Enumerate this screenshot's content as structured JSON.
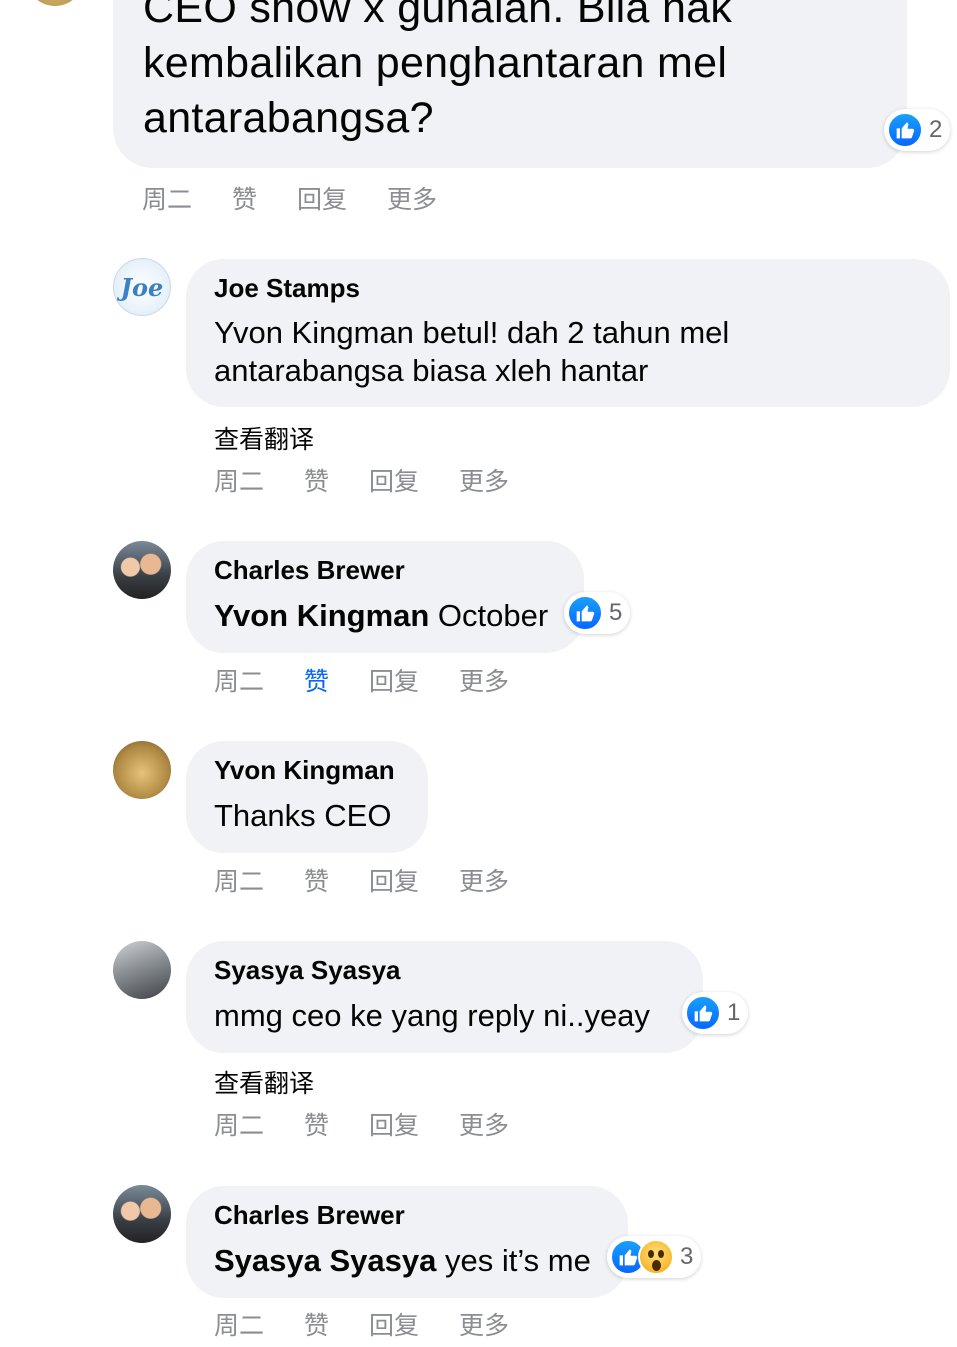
{
  "top_comment": {
    "text": "CEO show x gunalah. Bila nak kembalikan penghantaran mel antarabangsa?",
    "reactions": {
      "icons": [
        "like-icon"
      ],
      "count": "2"
    },
    "actions": {
      "time": "周二",
      "like": "赞",
      "reply": "回复",
      "more": "更多"
    }
  },
  "comments": [
    {
      "author": "Joe Stamps",
      "avatar_text": "Joe",
      "text": "Yvon Kingman betul! dah 2 tahun mel antarabangsa biasa xleh hantar",
      "translate": "查看翻译",
      "actions": {
        "time": "周二",
        "like": "赞",
        "reply": "回复",
        "more": "更多"
      }
    },
    {
      "author": "Charles Brewer",
      "mention": "Yvon Kingman",
      "text": " October",
      "reactions": {
        "icons": [
          "like-icon"
        ],
        "count": "5"
      },
      "actions": {
        "time": "周二",
        "like": "赞",
        "reply": "回复",
        "more": "更多",
        "liked": true
      }
    },
    {
      "author": "Yvon Kingman",
      "text": "Thanks CEO",
      "actions": {
        "time": "周二",
        "like": "赞",
        "reply": "回复",
        "more": "更多"
      }
    },
    {
      "author": "Syasya Syasya",
      "text": "mmg ceo ke yang reply ni..yeay",
      "reactions": {
        "icons": [
          "like-icon"
        ],
        "count": "1"
      },
      "translate": "查看翻译",
      "actions": {
        "time": "周二",
        "like": "赞",
        "reply": "回复",
        "more": "更多"
      }
    },
    {
      "author": "Charles Brewer",
      "mention": "Syasya Syasya",
      "text": " yes it’s me",
      "reactions": {
        "icons": [
          "like-icon",
          "wow-icon"
        ],
        "count": "3"
      },
      "actions": {
        "time": "周二",
        "like": "赞",
        "reply": "回复",
        "more": "更多"
      }
    }
  ],
  "colors": {
    "bubble": "#f0f2f5",
    "like_blue": "#0866ff",
    "meta_gray": "#8a8d91"
  }
}
